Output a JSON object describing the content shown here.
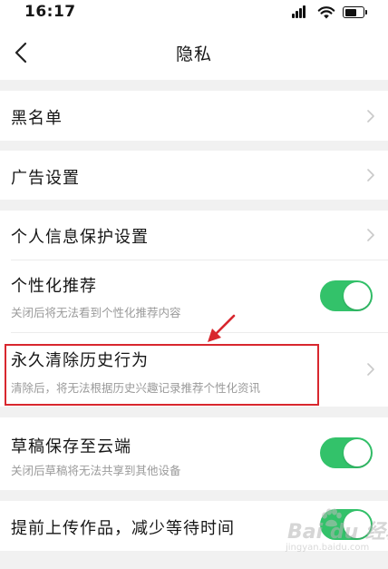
{
  "status_bar": {
    "time": "16:17"
  },
  "nav": {
    "title": "隐私"
  },
  "items": {
    "blacklist": {
      "label": "黑名单"
    },
    "ad_settings": {
      "label": "广告设置"
    },
    "personal_info": {
      "label": "个人信息保护设置"
    },
    "personalized_recommend": {
      "label": "个性化推荐",
      "sub": "关闭后将无法看到个性化推荐内容",
      "enabled": true
    },
    "clear_history": {
      "label": "永久清除历史行为",
      "sub": "清除后，将无法根据历史兴趣记录推荐个性化资讯"
    },
    "draft_cloud": {
      "label": "草稿保存至云端",
      "sub": "关闭后草稿将无法共享到其他设备",
      "enabled": true
    },
    "preupload": {
      "label": "提前上传作品，减少等待时间",
      "enabled": true
    }
  },
  "watermark": {
    "logo": "Bai du 经验",
    "url": "jingyan.baidu.com"
  },
  "colors": {
    "toggle_on": "#33c26a",
    "annotation": "#d8272e",
    "background": "#f1f1f1"
  }
}
